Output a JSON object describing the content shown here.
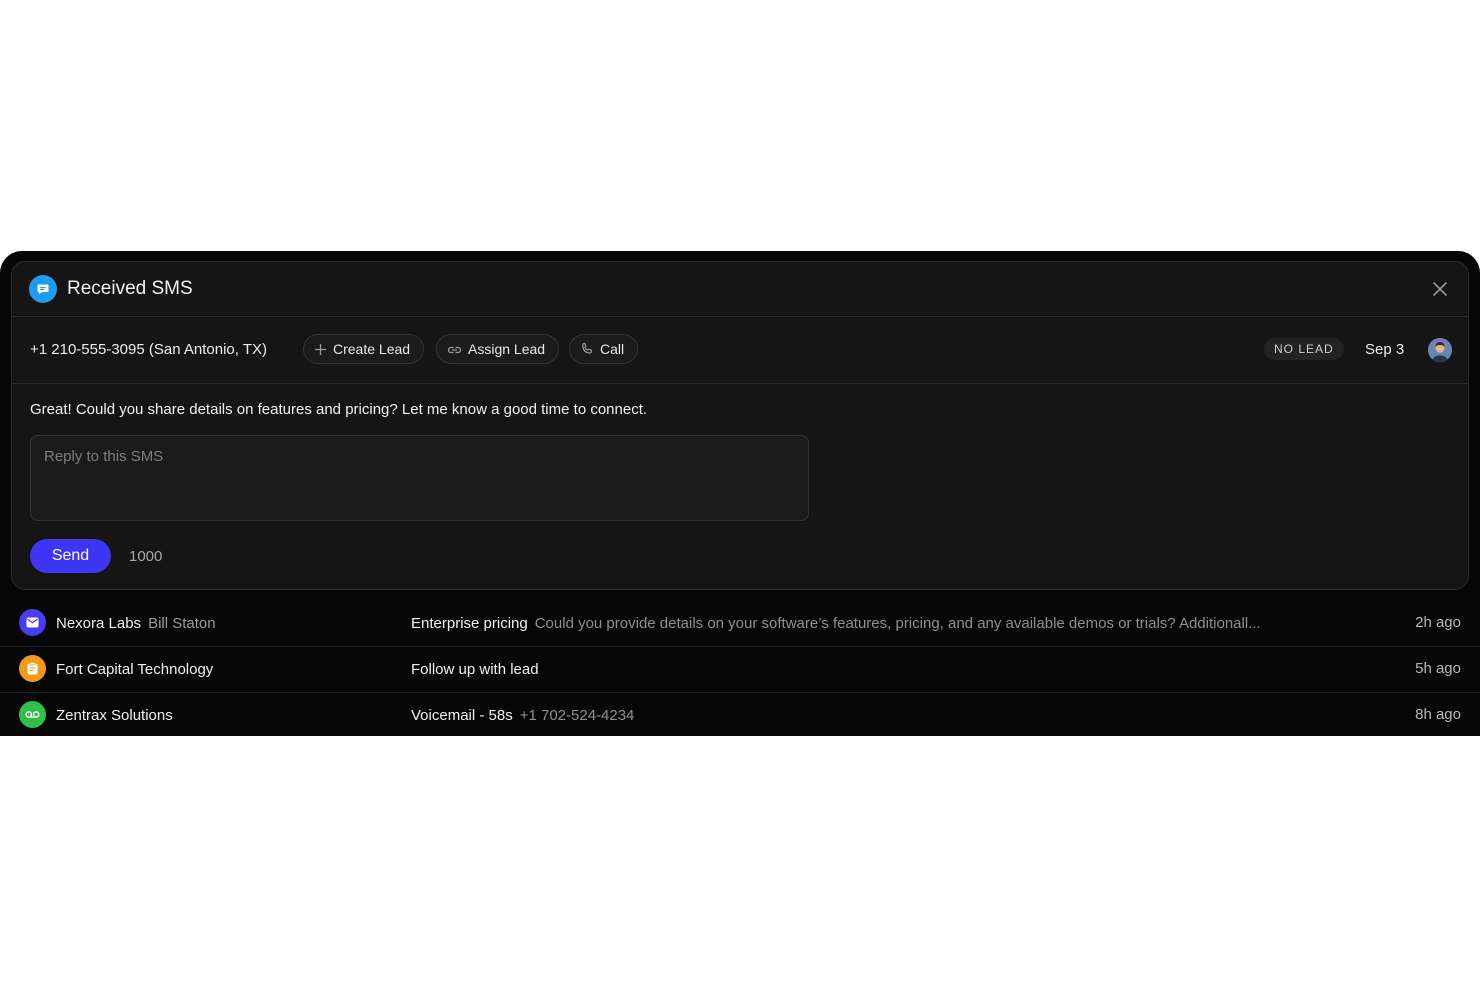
{
  "dialog": {
    "title": "Received SMS",
    "phone": "+1 210-555-3095 (San Antonio, TX)",
    "actions": {
      "create_lead": "Create Lead",
      "assign_lead": "Assign Lead",
      "call": "Call"
    },
    "lead_badge": "NO LEAD",
    "date": "Sep 3",
    "message": "Great! Could you share details on features and pricing? Let me know a good time to connect.",
    "reply": {
      "placeholder": "Reply to this SMS",
      "value": ""
    },
    "send_label": "Send",
    "char_count": "1000"
  },
  "inbox": [
    {
      "company": "Nexora Labs",
      "contact": "Bill Staton",
      "subject": "Enterprise pricing",
      "preview": "Could you provide details on your software’s features, pricing, and any available demos or trials? Additionall...",
      "time": "2h ago",
      "icon": "mail-icon",
      "icon_color": "#4a3df0"
    },
    {
      "company": "Fort Capital Technology",
      "contact": "",
      "subject": "Follow up with lead",
      "preview": "",
      "time": "5h ago",
      "icon": "clipboard-icon",
      "icon_color": "#f29a1a"
    },
    {
      "company": "Zentrax Solutions",
      "contact": "",
      "subject": "Voicemail - 58s",
      "preview": "+1 702-524-4234",
      "time": "8h ago",
      "icon": "voicemail-icon",
      "icon_color": "#2fbf4a"
    }
  ],
  "colors": {
    "accent": "#3d34f5",
    "sms_icon": "#1f9bf0",
    "background": "#060606",
    "card": "#151515"
  }
}
